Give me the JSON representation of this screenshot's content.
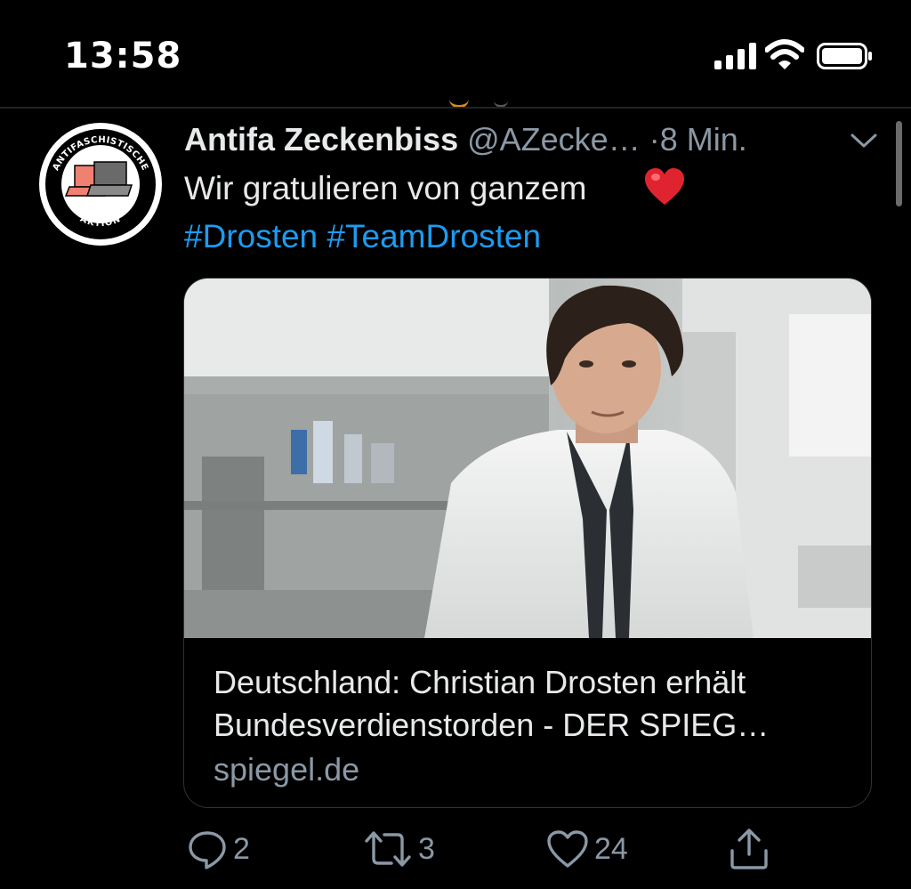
{
  "status_bar": {
    "time": "13:58",
    "icons": [
      "cellular-signal-icon",
      "wifi-icon",
      "battery-icon"
    ]
  },
  "tweet": {
    "author_name": "Antifa Zeckenbiss",
    "handle": "@AZecke…",
    "separator": "·",
    "time_ago": "8 Min.",
    "text": "Wir gratulieren von ganzem",
    "emoji": "❤️",
    "hashtags": [
      "#Drosten",
      "#TeamDrosten"
    ],
    "avatar": {
      "top_text": "ANTIFASCHISTISCHE",
      "bottom_text": "AKTION"
    }
  },
  "link_card": {
    "title": "Deutschland: Christian Drosten erhält Bundesverdienstorden - DER SPIEG…",
    "domain": "spiegel.de"
  },
  "actions": {
    "reply_count": "2",
    "retweet_count": "3",
    "like_count": "24"
  },
  "colors": {
    "accent": "#1d9bf0",
    "secondary_text": "#8b98a5",
    "background": "#000000"
  }
}
